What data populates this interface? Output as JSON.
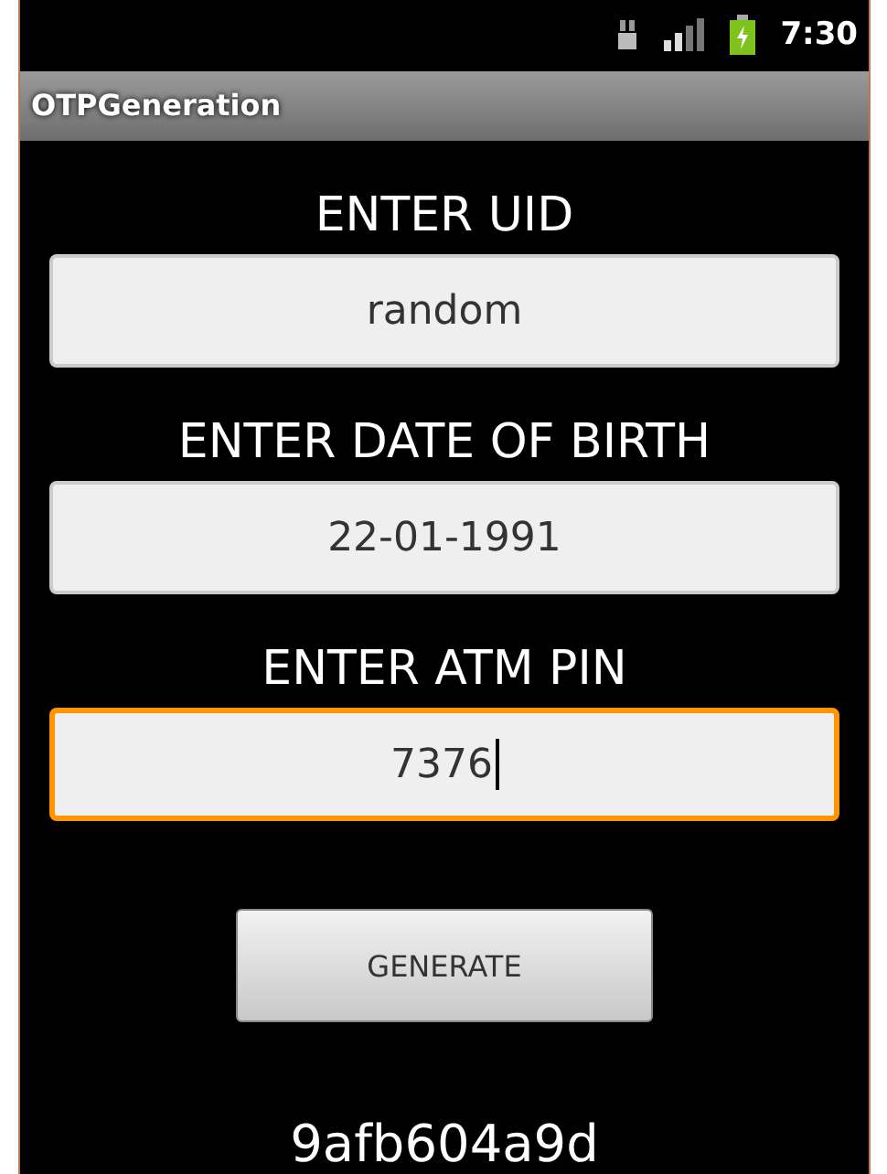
{
  "status_bar": {
    "time": "7:30"
  },
  "window": {
    "title": "OTPGeneration"
  },
  "fields": [
    {
      "label": "ENTER UID",
      "value": "random",
      "focused": false
    },
    {
      "label": "ENTER DATE OF BIRTH",
      "value": "22-01-1991",
      "focused": false
    },
    {
      "label": "ENTER ATM PIN",
      "value": "7376",
      "focused": true
    }
  ],
  "button": {
    "label": "GENERATE"
  },
  "result": "9afb604a9d"
}
